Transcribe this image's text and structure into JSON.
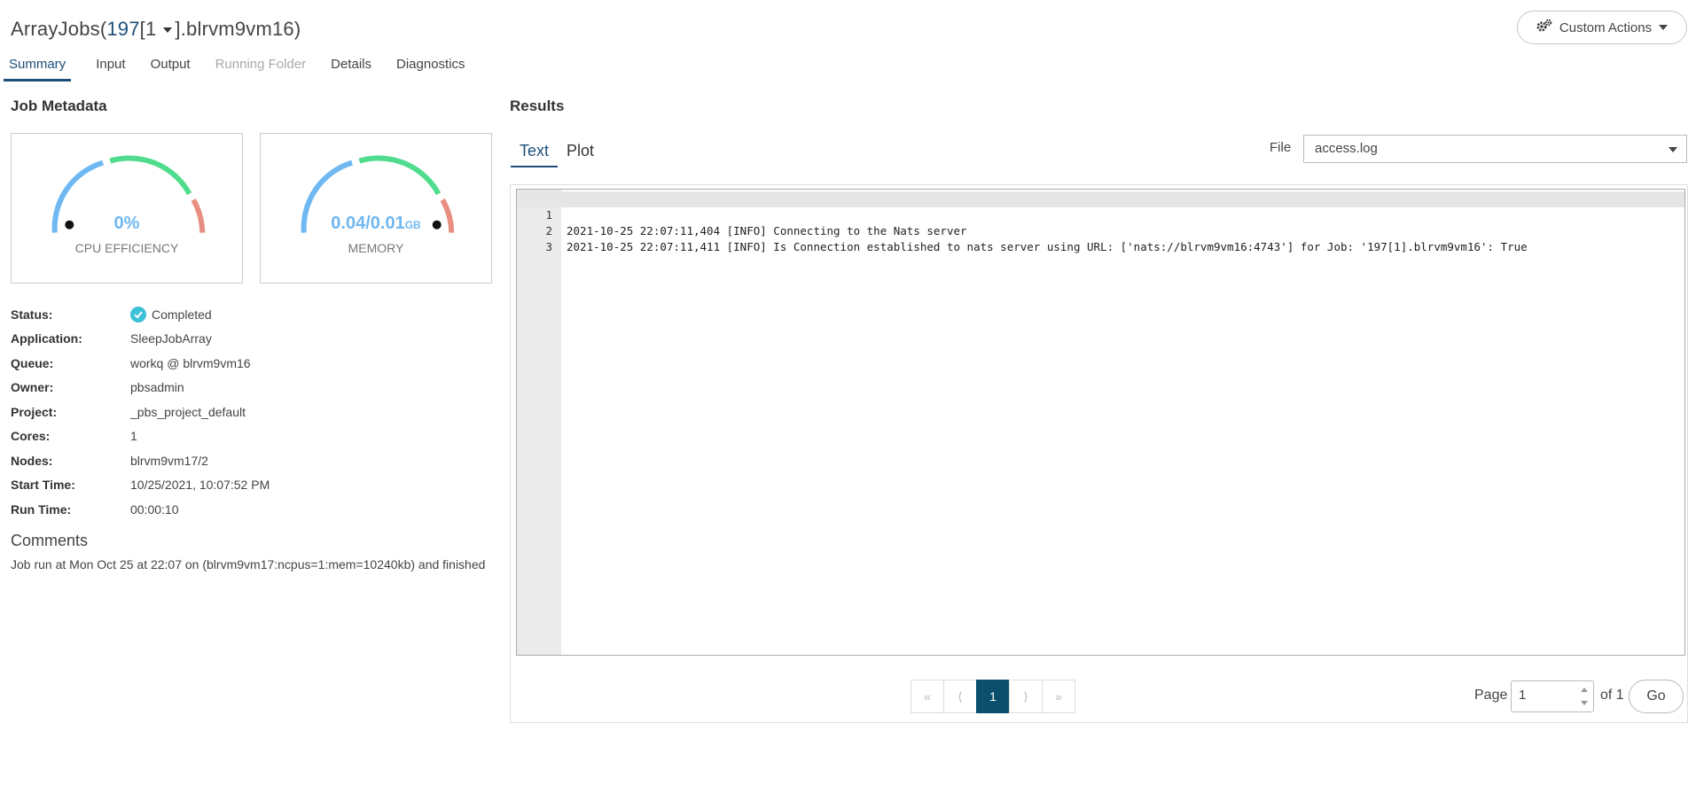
{
  "header": {
    "title_prefix": "ArrayJobs(",
    "title_num": "197",
    "title_index": "[1",
    "title_suffix": "].blrvm9vm16)",
    "custom_actions_label": "Custom Actions"
  },
  "tabs": [
    {
      "label": "Summary",
      "state": "active"
    },
    {
      "label": "Input",
      "state": "normal"
    },
    {
      "label": "Output",
      "state": "normal"
    },
    {
      "label": "Running Folder",
      "state": "disabled"
    },
    {
      "label": "Details",
      "state": "normal"
    },
    {
      "label": "Diagnostics",
      "state": "normal"
    }
  ],
  "job_metadata": {
    "title": "Job Metadata",
    "cpu": {
      "value": "0%",
      "label": "CPU EFFICIENCY",
      "needle_fraction": 0.0
    },
    "memory": {
      "value": "0.04/0.01",
      "unit": "GB",
      "label": "MEMORY",
      "needle_fraction": 1.0
    },
    "rows": [
      {
        "key": "Status:",
        "value": "Completed",
        "icon": "check-circle-icon"
      },
      {
        "key": "Application:",
        "value": "SleepJobArray"
      },
      {
        "key": "Queue:",
        "value": "workq @ blrvm9vm16"
      },
      {
        "key": "Owner:",
        "value": "pbsadmin"
      },
      {
        "key": "Project:",
        "value": "_pbs_project_default"
      },
      {
        "key": "Cores:",
        "value": "1"
      },
      {
        "key": "Nodes:",
        "value": "blrvm9vm17/2"
      },
      {
        "key": "Start Time:",
        "value": "10/25/2021, 10:07:52 PM"
      },
      {
        "key": "Run Time:",
        "value": "00:00:10"
      }
    ],
    "comments_title": "Comments",
    "comments_text": "Job run at Mon Oct 25 at 22:07 on (blrvm9vm17:ncpus=1:mem=10240kb) and finished"
  },
  "results": {
    "title": "Results",
    "tabs": [
      {
        "label": "Text",
        "active": true
      },
      {
        "label": "Plot",
        "active": false
      }
    ],
    "file_label": "File",
    "file_value": "access.log",
    "lines": [
      {
        "n": "1",
        "text": "2021-10-25 22:07:11,404 [INFO] Connecting to the Nats server"
      },
      {
        "n": "2",
        "text": "2021-10-25 22:07:11,411 [INFO] Is Connection established to nats server using URL: ['nats://blrvm9vm16:4743'] for Job: '197[1].blrvm9vm16': True"
      },
      {
        "n": "3",
        "text": ""
      }
    ],
    "pagination": {
      "first": "«",
      "prev": "⟨",
      "current": "1",
      "next": "⟩",
      "last": "»",
      "page_label": "Page",
      "page_value": "1",
      "of_label": "of 1",
      "go_label": "Go"
    }
  },
  "colors": {
    "accent": "#1d4f7a",
    "gauge_blue": "#6fb8f2",
    "gauge_green": "#4fdc8c",
    "gauge_red": "#e88e80",
    "status_check": "#3cc1d6",
    "page_active": "#0b4f6c"
  }
}
